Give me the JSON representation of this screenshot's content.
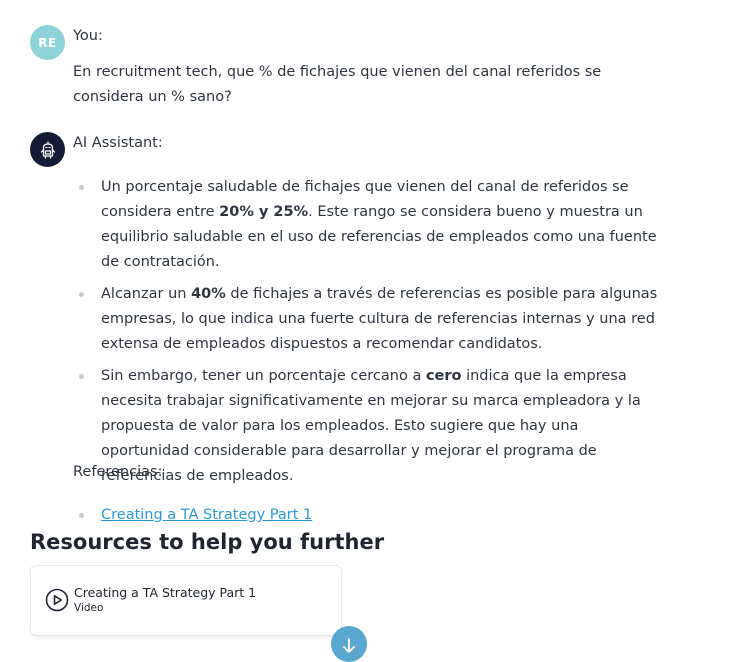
{
  "user_message": {
    "avatar_initials": "RE",
    "sender": "You:",
    "text": "En recruitment tech, que % de fichajes que vienen del canal referidos se considera un % sano?"
  },
  "assistant_message": {
    "sender": "AI Assistant:",
    "bullets": [
      {
        "before": "Un porcentaje saludable de fichajes que vienen del canal de referidos se considera entre ",
        "bold": "20% y 25%",
        "after": ". Este rango se considera bueno y muestra un equilibrio saludable en el uso de referencias de empleados como una fuente de contratación."
      },
      {
        "before": "Alcanzar un ",
        "bold": "40%",
        "after": " de fichajes a través de referencias es posible para algunas empresas, lo que indica una fuerte cultura de referencias internas y una red extensa de empleados dispuestos a recomendar candidatos."
      },
      {
        "before": "Sin embargo, tener un porcentaje cercano a ",
        "bold": "cero",
        "after": " indica que la empresa necesita trabajar significativamente en mejorar su marca empleadora y la propuesta de valor para los empleados. Esto sugiere que hay una oportunidad considerable para desarrollar y mejorar el programa de referencias de empleados."
      }
    ],
    "references_label": "Referencias:",
    "references": [
      {
        "label": "Creating a TA Strategy Part 1"
      }
    ]
  },
  "resources": {
    "heading": "Resources to help you further",
    "cards": [
      {
        "title": "Creating a TA Strategy Part 1",
        "type": "Video"
      }
    ]
  },
  "colors": {
    "user_avatar": "#8ed3d8",
    "assistant_avatar": "#141b34",
    "link": "#2a9ad6",
    "scroll_button": "#5aa7cf"
  },
  "icons": {
    "assistant_avatar": "robot-icon",
    "resource_card": "play-circle-icon",
    "scroll_button": "arrow-down-icon"
  }
}
